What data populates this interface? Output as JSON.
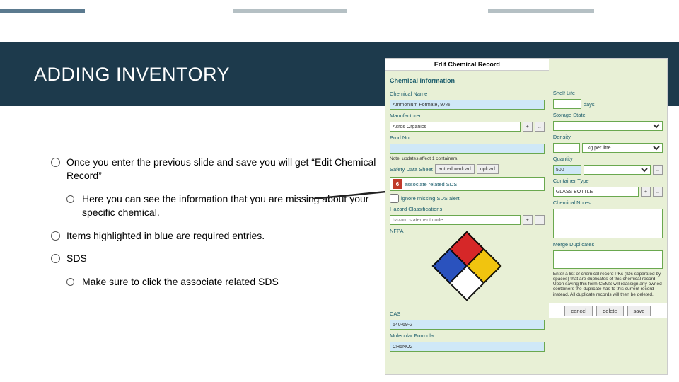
{
  "slide": {
    "title": "ADDING INVENTORY",
    "bullets": {
      "b1": "Once you enter the previous slide and save you will get “Edit Chemical Record”",
      "b1a": "Here you can see the information that you are missing about your specific chemical.",
      "b2": "Items highlighted in blue are required entries.",
      "b3": "SDS",
      "b3a": "Make sure to click the associate related SDS"
    }
  },
  "panel": {
    "header": "Edit Chemical Record",
    "section_chem_info": "Chemical Information",
    "labels": {
      "chem_name": "Chemical Name",
      "manufacturer": "Manufacturer",
      "prod_no": "Prod.No",
      "note_containers": "Note: updates affect 1 containers.",
      "sds_row": "Safety Data Sheet",
      "sds_assoc": "associate related SDS",
      "sds_ignore": "ignore missing SDS alert",
      "hazard_class": "Hazard Classifications",
      "hazard_ph": "hazard statement code",
      "nfpa": "NFPA",
      "cas": "CAS",
      "mol_formula": "Molecular Formula",
      "shelf_life": "Shelf Life",
      "days": "days",
      "storage_state": "Storage State",
      "density": "Density",
      "density_unit": "kg per litre",
      "quantity": "Quantity",
      "container_type": "Container Type",
      "chem_notes": "Chemical Notes",
      "merge": "Merge Duplicates",
      "merge_note": "Enter a list of chemical record PKs (IDs separated by spaces) that are duplicates of this chemical record. Upon saving this form CEMS will reassign any owned containers the duplicate has to this current record instead. All duplicate records will then be deleted.",
      "w_download": "auto-download",
      "w_upload": "upload"
    },
    "values": {
      "chem_name": "Ammonium Formate, 97%",
      "manufacturer": "Acros Organics",
      "prod_no": "",
      "quantity": "500",
      "container_type": "GLASS BOTTLE",
      "cas": "540-69-2",
      "mol_formula": "CH5NO2"
    },
    "buttons": {
      "cancel": "cancel",
      "delete": "delete",
      "save": "save",
      "dot": "..",
      "plus": "+"
    }
  }
}
